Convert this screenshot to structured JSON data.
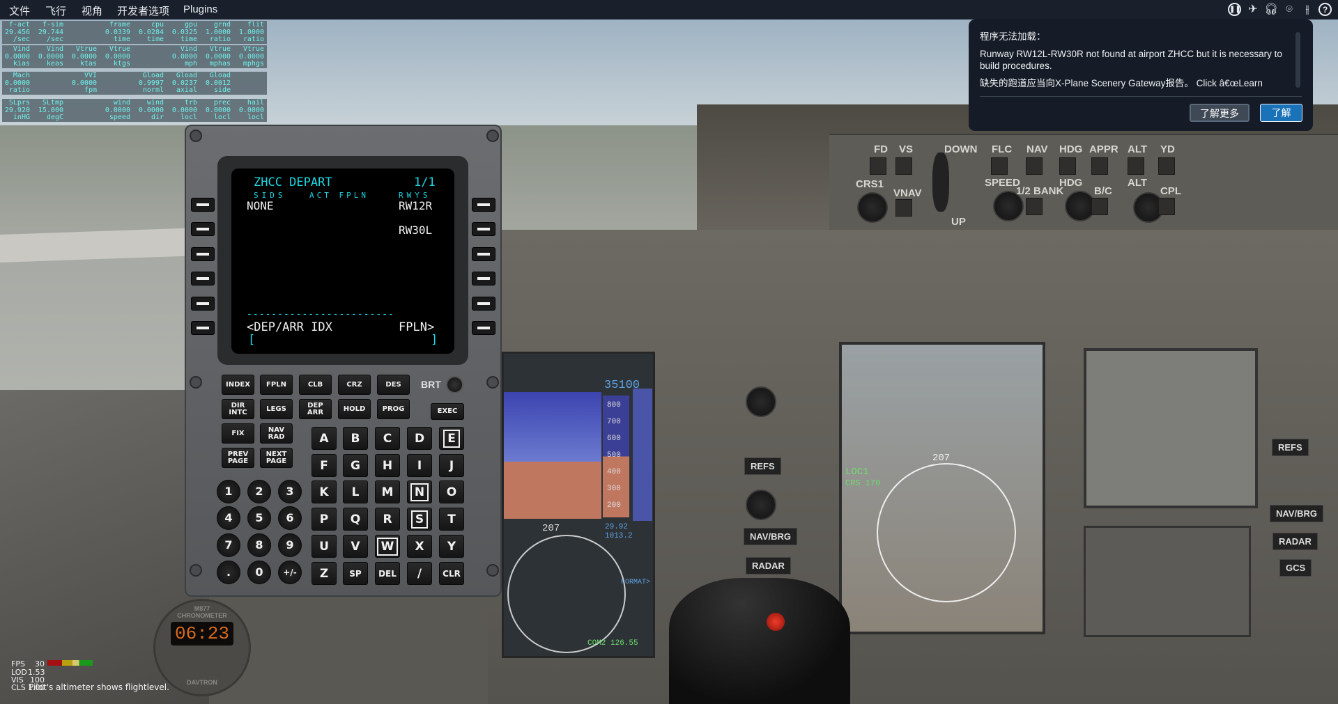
{
  "menubar": {
    "items": [
      "文件",
      "飞行",
      "视角",
      "开发者选项",
      "Plugins"
    ],
    "icons": [
      "pause-icon",
      "airplane-icon",
      "headset-icon",
      "location-pin-icon",
      "sliders-icon",
      "help-icon"
    ]
  },
  "data_output": {
    "rows": [
      [
        [
          "f-act",
          "29.456",
          "/sec"
        ],
        [
          "f-sim",
          "29.744",
          "/sec"
        ],
        [
          "",
          "",
          ""
        ],
        [
          "frame",
          "0.0339",
          "time"
        ],
        [
          "cpu",
          "0.0284",
          "time"
        ],
        [
          "gpu",
          "0.0325",
          "time"
        ],
        [
          "grnd",
          "1.0000",
          "ratio"
        ],
        [
          "flit",
          "1.0000",
          "ratio"
        ]
      ],
      [
        [
          "Vind",
          "0.0000",
          "kias"
        ],
        [
          "Vind",
          "0.0000",
          "keas"
        ],
        [
          "Vtrue",
          "0.0000",
          "ktas"
        ],
        [
          "Vtrue",
          "0.0000",
          "ktgs"
        ],
        [
          "",
          "",
          ""
        ],
        [
          "Vind",
          "0.0000",
          "mph"
        ],
        [
          "Vtrue",
          "0.0000",
          "mphas"
        ],
        [
          "Vtrue",
          "0.0000",
          "mphgs"
        ]
      ],
      [
        [
          "Mach",
          "0.0000",
          "ratio"
        ],
        [
          "",
          "",
          ""
        ],
        [
          "VVI",
          "0.0000",
          "fpm"
        ],
        [
          "",
          "",
          ""
        ],
        [
          "Gload",
          "0.9997",
          "norml"
        ],
        [
          "Gload",
          "0.0237",
          "axial"
        ],
        [
          "Gload",
          "0.0012",
          "side"
        ],
        [
          "",
          "",
          ""
        ]
      ],
      [
        [
          "SLprs",
          "29.920",
          "inHG"
        ],
        [
          "SLtmp",
          "15.000",
          "degC"
        ],
        [
          "",
          "",
          ""
        ],
        [
          "wind",
          "0.0000",
          "speed"
        ],
        [
          "wind",
          "0.0000",
          "dir"
        ],
        [
          "trb",
          "0.0000",
          "locl"
        ],
        [
          "prec",
          "0.0000",
          "locl"
        ],
        [
          "hail",
          "0.0000",
          "locl"
        ]
      ]
    ]
  },
  "fms": {
    "screen": {
      "title": "ZHCC DEPART",
      "page": "1/1",
      "label_left": "SIDS",
      "label_center": "ACT FPLN",
      "label_right": "RWYS",
      "sid": "NONE",
      "runway_1": "RW12R",
      "runway_2": "RW30L",
      "divider": "------------------------",
      "lsk_left_6": "<DEP/ARR IDX",
      "lsk_right_6": "FPLN>",
      "bracket_left": "[",
      "bracket_right": "]"
    },
    "function_keys": [
      [
        "INDEX",
        "FPLN",
        "CLB",
        "CRZ",
        "DES"
      ],
      [
        "DIR\nINTC",
        "LEGS",
        "DEP\nARR",
        "HOLD",
        "PROG"
      ],
      [
        "FIX",
        "NAV\nRAD"
      ],
      [
        "PREV\nPAGE",
        "NEXT\nPAGE"
      ]
    ],
    "brt_label": "BRT",
    "exec_label": "EXEC",
    "letter_keys": [
      [
        "A",
        "B",
        "C",
        "D",
        "E"
      ],
      [
        "F",
        "G",
        "H",
        "I",
        "J"
      ],
      [
        "K",
        "L",
        "M",
        "N",
        "O"
      ],
      [
        "P",
        "Q",
        "R",
        "S",
        "T"
      ],
      [
        "U",
        "V",
        "W",
        "X",
        "Y"
      ],
      [
        "Z",
        "SP",
        "DEL",
        "/",
        "CLR"
      ]
    ],
    "highlighted_keys": [
      "E",
      "N",
      "S",
      "W"
    ],
    "number_keys": [
      [
        "1",
        "2",
        "3"
      ],
      [
        "4",
        "5",
        "6"
      ],
      [
        "7",
        "8",
        "9"
      ],
      [
        ".",
        "0",
        "+/-"
      ]
    ]
  },
  "notification": {
    "title": "程序无法加载：",
    "message": "Runway RW12L-RW30R not found at airport ZHCC but it is necessary to build procedures.",
    "message_2": "缺失的跑道应当向X-Plane Scenery Gateway报告。 Click â€œLearn",
    "learn_more_button": "了解更多",
    "ok_button": "了解",
    "accent_color": "#1a72b8"
  },
  "autopilot": {
    "labels": [
      "FD",
      "CRS1",
      "VS",
      "VNAV",
      "DOWN",
      "UP",
      "FLC",
      "SPEED",
      "NAV",
      "1/2 BANK",
      "HDG",
      "HDG",
      "APPR",
      "B/C",
      "ALT",
      "ALT",
      "YD",
      "CPL"
    ]
  },
  "pfd": {
    "alt_bug": "35100",
    "alt_ticks": [
      "800",
      "700",
      "600",
      "500",
      "400",
      "300",
      "200"
    ],
    "heading": "207",
    "baro_in": "29.92",
    "baro_hpa": "1013.2",
    "format": "FORMAT>",
    "com2": "COM2 126.55"
  },
  "mfd": {
    "mode": "LOC1",
    "crs": "CRS 170",
    "heading": "207"
  },
  "side_panel": {
    "refs": "REFS",
    "navbrg": "NAV/BRG",
    "radar": "RADAR",
    "gcs": "GCS"
  },
  "chronometer": {
    "model": "M877",
    "title": "CHRONOMETER",
    "time": "06:23",
    "brand": "DAVTRON"
  },
  "hud_stats": {
    "fps_label": "FPS",
    "fps": "30",
    "lod_label": "LOD",
    "lod": "1.53",
    "vis_label": "VIS",
    "vis": "100",
    "cls_label": "CLS",
    "cls": "1.00"
  },
  "status_message": "Pilot's altimeter shows flightlevel."
}
